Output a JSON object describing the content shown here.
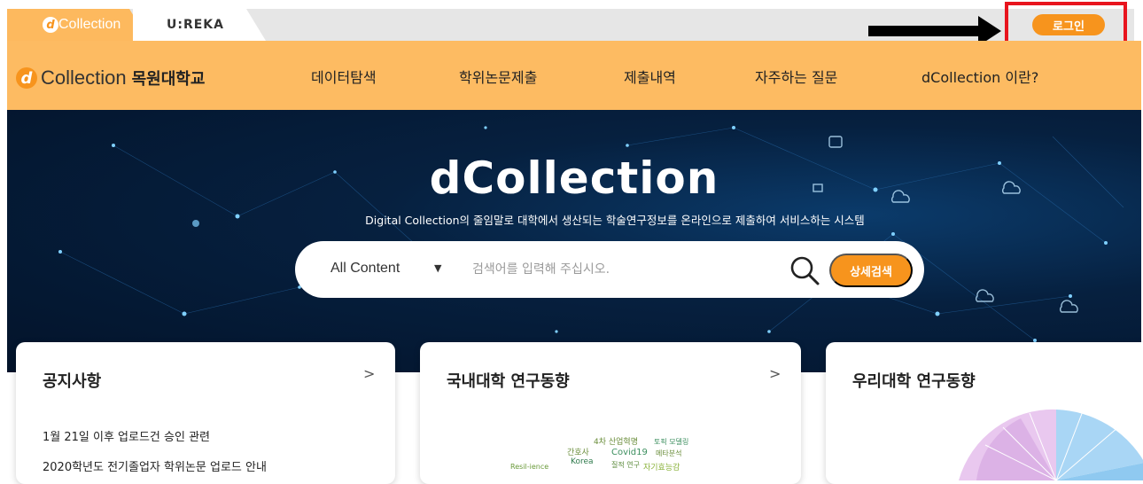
{
  "top_tabs": {
    "dcollection": "Collection",
    "ureka": "U:REKA"
  },
  "login_label": "로그인",
  "brand": {
    "logo_letter": "d",
    "collection": "Collection",
    "university": "목원대학교"
  },
  "nav": [
    "데이터탐색",
    "학위논문제출",
    "제출내역",
    "자주하는 질문",
    "dCollection 이란?"
  ],
  "hero": {
    "title": "dCollection",
    "subtitle": "Digital Collection의 줄임말로 대학에서 생산되는 학술연구정보를 온라인으로 제출하여 서비스하는 시스템"
  },
  "search": {
    "scope": "All Content",
    "placeholder": "검색어를 입력해 주십시오.",
    "detail_button": "상세검색"
  },
  "cards": {
    "notice": {
      "title": "공지사항",
      "more": ">",
      "items": [
        "1월 21일 이후 업로드건 승인 관련",
        "2020학년도 전기졸업자 학위논문 업로드 안내"
      ]
    },
    "domestic": {
      "title": "국내대학 연구동향",
      "more": ">",
      "words": [
        "4차 산업혁명",
        "토픽 모델링",
        "간호사",
        "Covid19",
        "메타분석",
        "Korea",
        "질적 연구",
        "자기효능감",
        "Resil-ience"
      ]
    },
    "ours": {
      "title": "우리대학 연구동향"
    }
  },
  "colors": {
    "accent": "#f7941d",
    "nav_bg": "#fdbb62",
    "annotation_red": "#e8141e"
  },
  "icons": [
    "search-icon",
    "dropdown-caret-icon",
    "arrow-icon"
  ]
}
